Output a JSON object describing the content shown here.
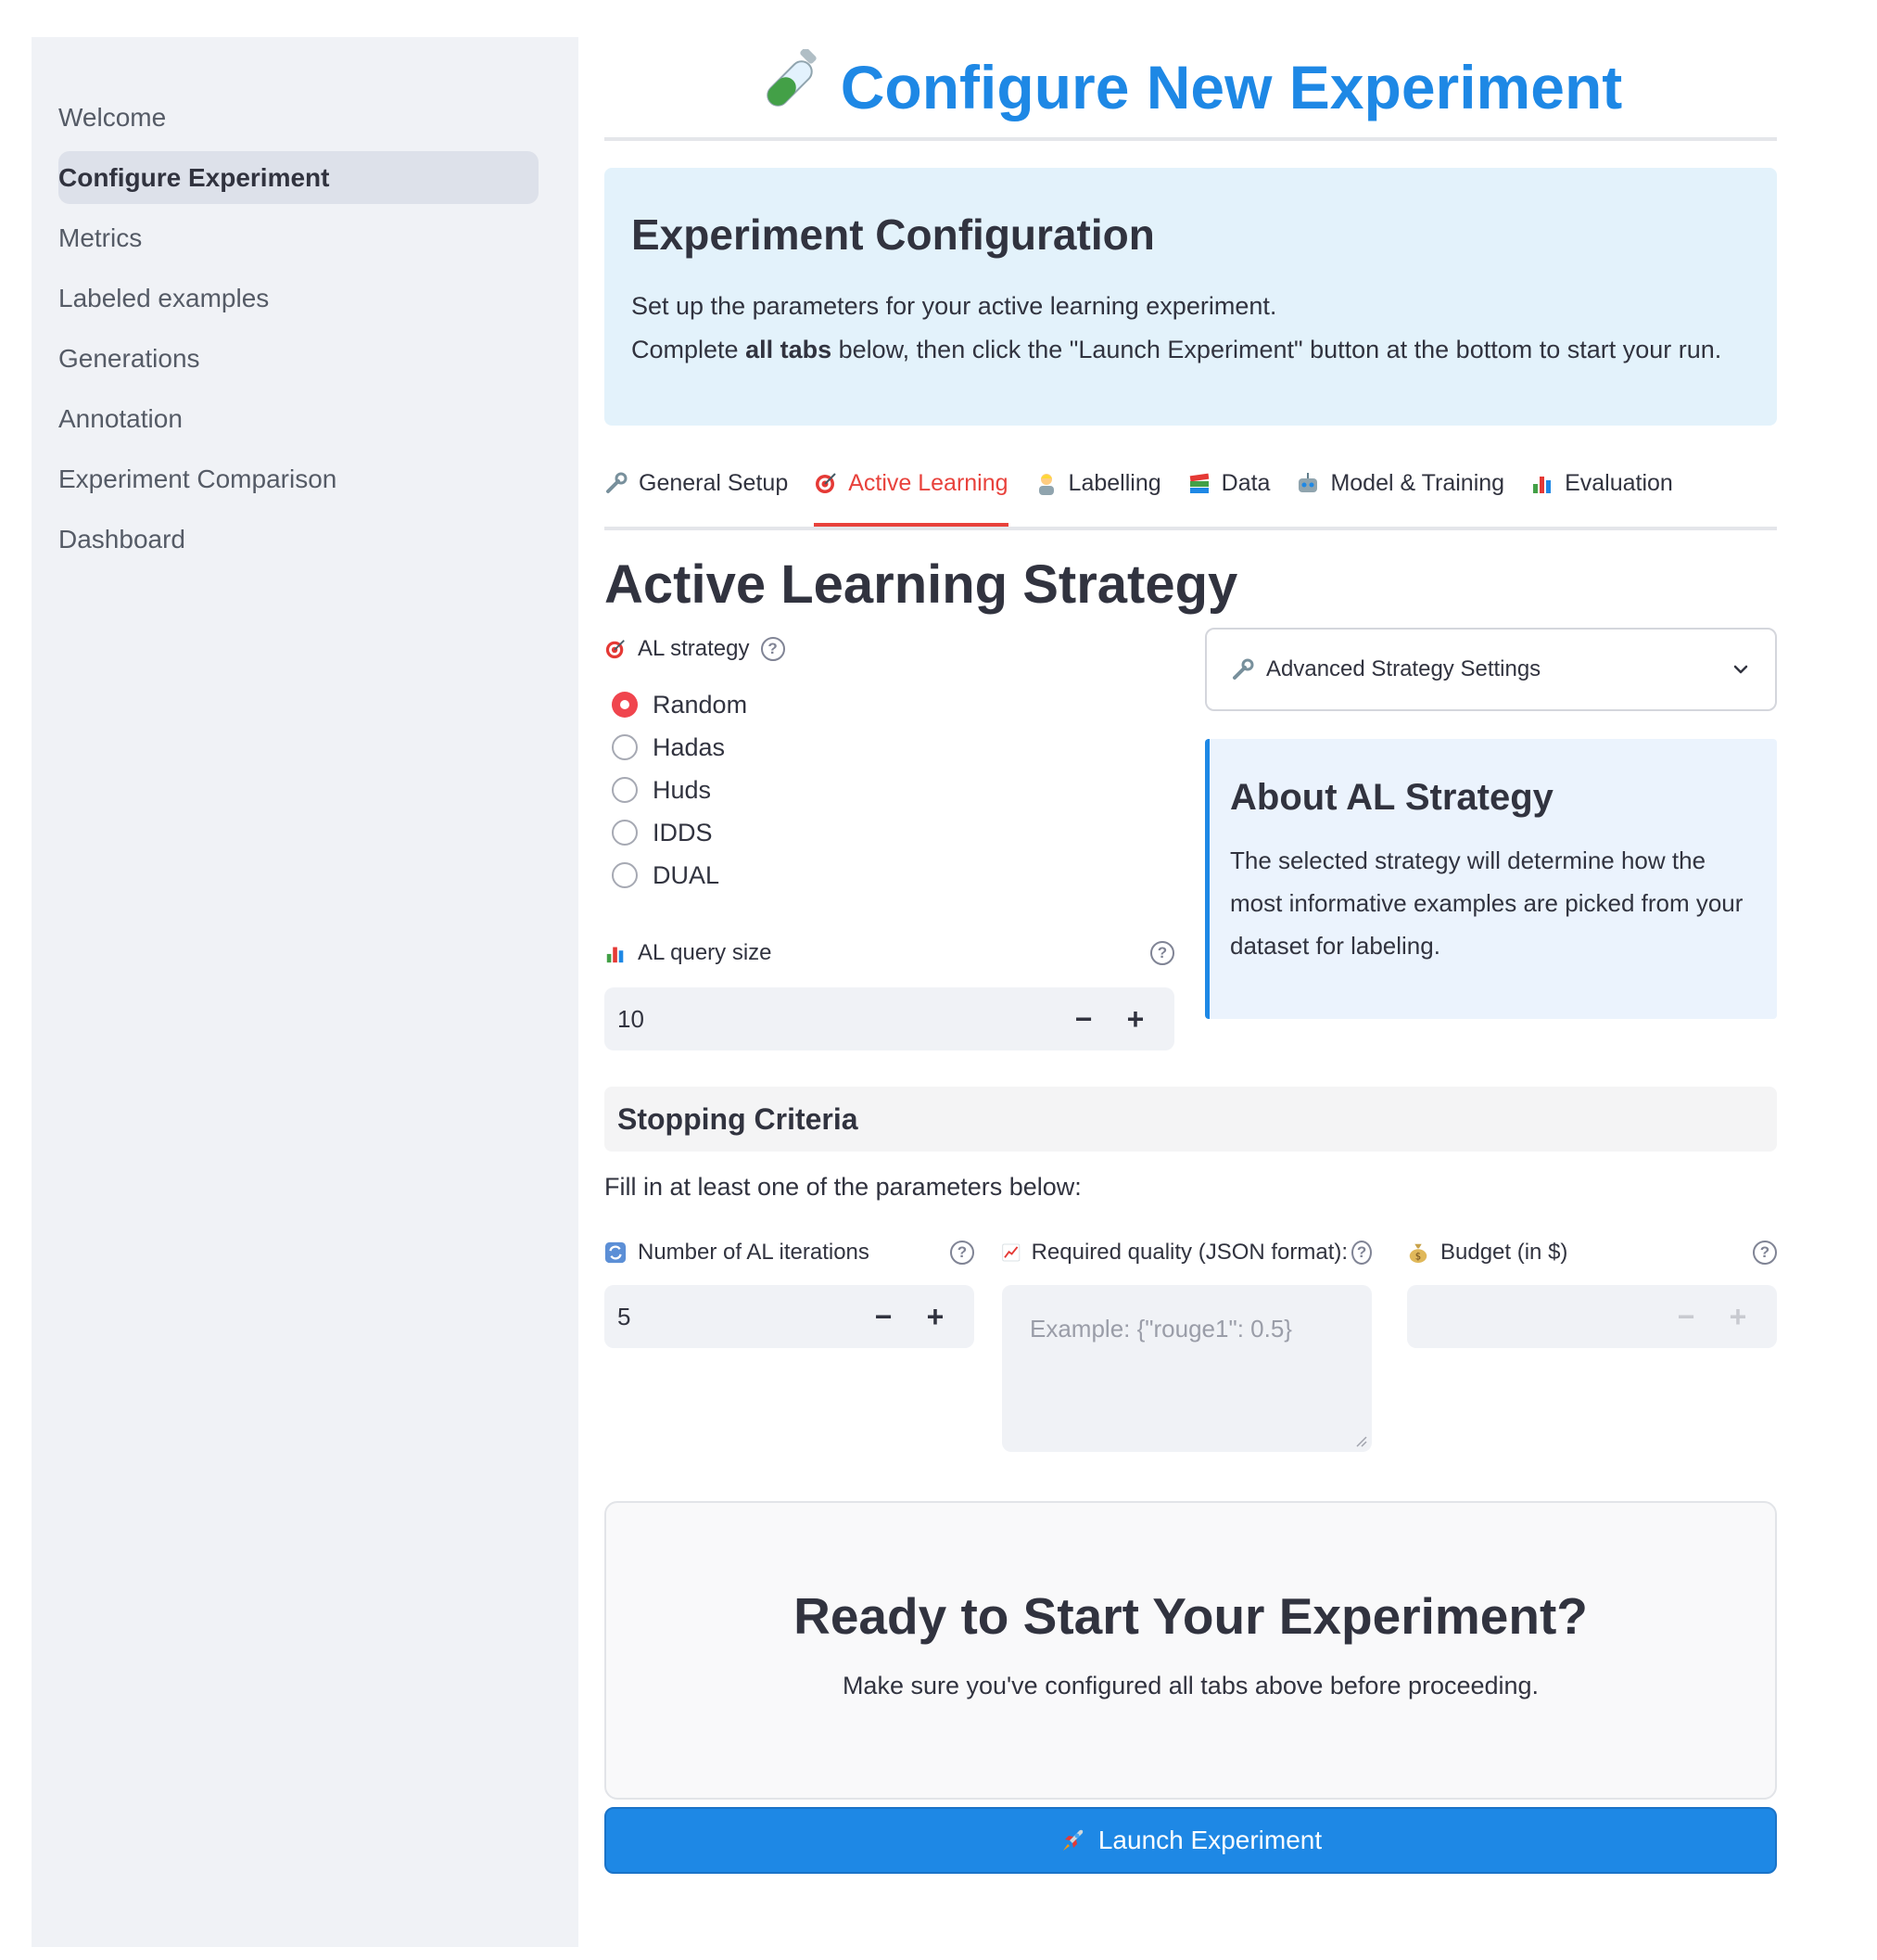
{
  "sidebar": {
    "items": [
      {
        "label": "Welcome"
      },
      {
        "label": "Configure Experiment"
      },
      {
        "label": "Metrics"
      },
      {
        "label": "Labeled examples"
      },
      {
        "label": "Generations"
      },
      {
        "label": "Annotation"
      },
      {
        "label": "Experiment Comparison"
      },
      {
        "label": "Dashboard"
      }
    ],
    "active_index": 1
  },
  "header": {
    "title": "Configure New Experiment",
    "icon": "test-tube-icon"
  },
  "intro": {
    "heading": "Experiment Configuration",
    "line1": "Set up the parameters for your active learning experiment.",
    "line2_pre": "Complete ",
    "line2_bold": "all tabs",
    "line2_post": " below, then click the \"Launch Experiment\" button at the bottom to start your run."
  },
  "tabs": [
    {
      "label": "General Setup",
      "icon": "wrench-icon"
    },
    {
      "label": "Active Learning",
      "icon": "target-icon",
      "active": true
    },
    {
      "label": "Labelling",
      "icon": "person-icon"
    },
    {
      "label": "Data",
      "icon": "books-icon"
    },
    {
      "label": "Model & Training",
      "icon": "robot-icon"
    },
    {
      "label": "Evaluation",
      "icon": "bar-chart-icon"
    }
  ],
  "section": {
    "title": "Active Learning Strategy"
  },
  "al_strategy": {
    "label": "AL strategy",
    "options": [
      "Random",
      "Hadas",
      "Huds",
      "IDDS",
      "DUAL"
    ],
    "selected": "Random"
  },
  "al_query_size": {
    "label": "AL query size",
    "value": "10",
    "minus": "−",
    "plus": "+"
  },
  "advanced": {
    "label": "Advanced Strategy Settings"
  },
  "about": {
    "heading": "About AL Strategy",
    "text": "The selected strategy will determine how the most informative examples are picked from your dataset for labeling."
  },
  "stopping": {
    "heading": "Stopping Criteria",
    "subtitle": "Fill in at least one of the parameters below:",
    "iterations": {
      "label": "Number of AL iterations",
      "value": "5",
      "minus": "−",
      "plus": "+"
    },
    "quality": {
      "label": "Required quality (JSON format):",
      "placeholder": "Example: {\"rouge1\": 0.5}"
    },
    "budget": {
      "label": "Budget (in $)",
      "value": "",
      "minus": "−",
      "plus": "+"
    }
  },
  "ready": {
    "heading": "Ready to Start Your Experiment?",
    "text": "Make sure you've configured all tabs above before proceeding."
  },
  "launch": {
    "label": "Launch Experiment"
  },
  "colors": {
    "accent": "#1e88e5",
    "active_tab": "#e8423c",
    "radio_selected": "#f0454e"
  }
}
